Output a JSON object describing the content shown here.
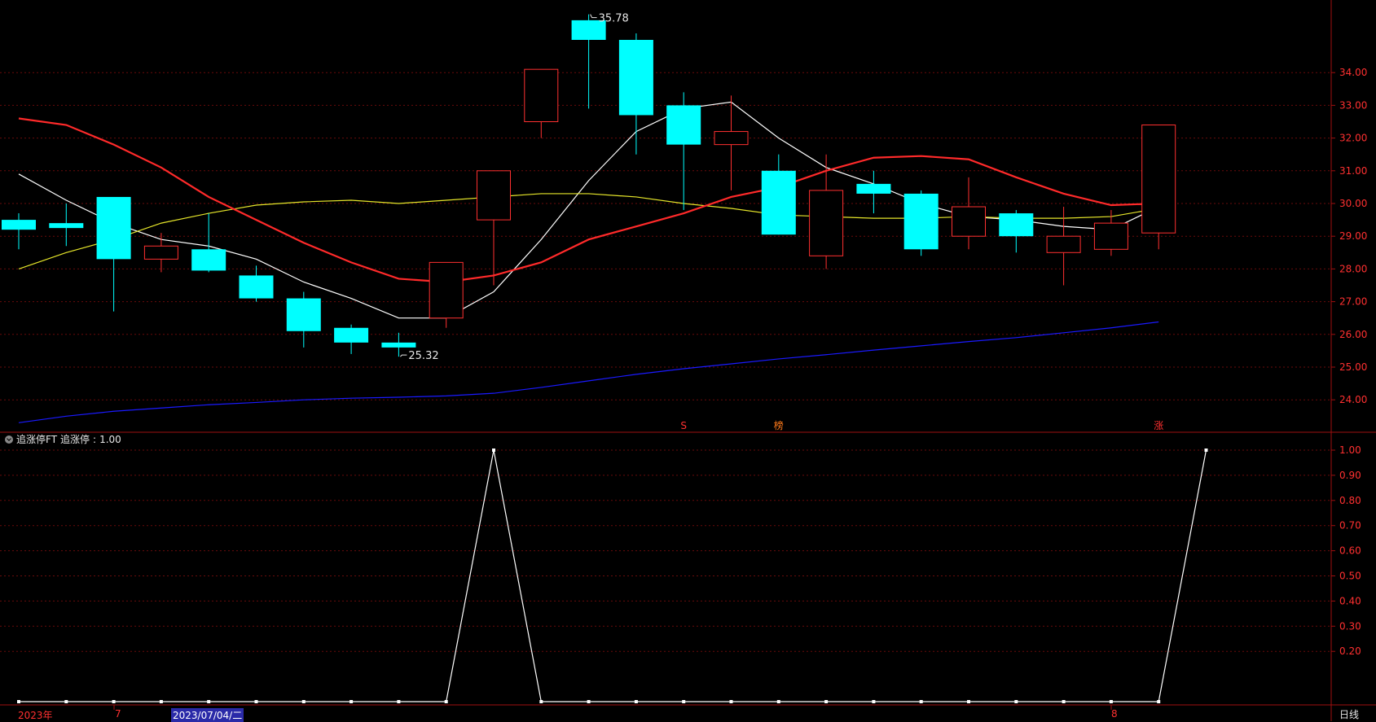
{
  "chart_data": [
    {
      "type": "candlestick",
      "ylim": [
        23.0,
        36.1
      ],
      "y_ticks": [
        "34.00",
        "33.00",
        "32.00",
        "31.00",
        "30.00",
        "29.00",
        "28.00",
        "27.00",
        "26.00",
        "25.00",
        "24.00"
      ],
      "up_color": "#ff3030",
      "down_color": "#00ffff",
      "candles": [
        {
          "o": 29.5,
          "h": 29.7,
          "l": 28.6,
          "c": 29.2
        },
        {
          "o": 29.4,
          "h": 30.0,
          "l": 28.7,
          "c": 29.25
        },
        {
          "o": 30.2,
          "h": 30.2,
          "l": 26.7,
          "c": 28.3
        },
        {
          "o": 28.3,
          "h": 29.1,
          "l": 27.9,
          "c": 28.7
        },
        {
          "o": 28.6,
          "h": 29.7,
          "l": 27.9,
          "c": 27.95
        },
        {
          "o": 27.8,
          "h": 28.1,
          "l": 27.0,
          "c": 27.1
        },
        {
          "o": 27.1,
          "h": 27.3,
          "l": 25.6,
          "c": 26.1
        },
        {
          "o": 26.2,
          "h": 26.3,
          "l": 25.4,
          "c": 25.75
        },
        {
          "o": 25.75,
          "h": 26.05,
          "l": 25.32,
          "c": 25.6
        },
        {
          "o": 26.5,
          "h": 28.2,
          "l": 26.2,
          "c": 28.2
        },
        {
          "o": 29.5,
          "h": 31.0,
          "l": 27.5,
          "c": 31.0
        },
        {
          "o": 32.5,
          "h": 34.1,
          "l": 32.0,
          "c": 34.1
        },
        {
          "o": 35.6,
          "h": 35.78,
          "l": 32.9,
          "c": 35.0
        },
        {
          "o": 35.0,
          "h": 35.2,
          "l": 31.5,
          "c": 32.7
        },
        {
          "o": 33.0,
          "h": 33.4,
          "l": 29.8,
          "c": 31.8
        },
        {
          "o": 31.8,
          "h": 33.3,
          "l": 30.4,
          "c": 32.2
        },
        {
          "o": 31.0,
          "h": 31.5,
          "l": 29.05,
          "c": 29.05
        },
        {
          "o": 28.4,
          "h": 31.5,
          "l": 28.0,
          "c": 30.4
        },
        {
          "o": 30.6,
          "h": 31.0,
          "l": 29.7,
          "c": 30.3
        },
        {
          "o": 30.3,
          "h": 30.4,
          "l": 28.4,
          "c": 28.6
        },
        {
          "o": 29.0,
          "h": 30.8,
          "l": 28.6,
          "c": 29.9
        },
        {
          "o": 29.7,
          "h": 29.8,
          "l": 28.5,
          "c": 29.0
        },
        {
          "o": 28.5,
          "h": 29.9,
          "l": 27.5,
          "c": 29.0
        },
        {
          "o": 28.6,
          "h": 29.8,
          "l": 28.4,
          "c": 29.4
        },
        {
          "o": 29.1,
          "h": 32.4,
          "l": 28.6,
          "c": 32.4
        }
      ],
      "ma_lines": [
        {
          "color": "#ffffff",
          "values": [
            30.9,
            30.1,
            29.4,
            28.9,
            28.7,
            28.3,
            27.6,
            27.1,
            26.5,
            26.5,
            27.3,
            28.9,
            30.7,
            32.2,
            32.9,
            33.1,
            32.0,
            31.1,
            30.6,
            30.0,
            29.6,
            29.5,
            29.3,
            29.2,
            29.9
          ]
        },
        {
          "color": "#e6e62a",
          "values": [
            28.0,
            28.5,
            28.9,
            29.4,
            29.7,
            29.95,
            30.05,
            30.1,
            30.0,
            30.1,
            30.2,
            30.3,
            30.3,
            30.2,
            30.0,
            29.85,
            29.65,
            29.6,
            29.55,
            29.55,
            29.6,
            29.55,
            29.55,
            29.6,
            29.85
          ]
        },
        {
          "color": "#ff2a2a",
          "values": [
            32.6,
            32.4,
            31.8,
            31.1,
            30.2,
            29.5,
            28.8,
            28.2,
            27.7,
            27.6,
            27.8,
            28.2,
            28.9,
            29.3,
            29.7,
            30.2,
            30.5,
            31.0,
            31.4,
            31.45,
            31.35,
            30.8,
            30.3,
            29.95,
            30.0
          ]
        },
        {
          "color": "#1a1aff",
          "values": [
            23.3,
            23.5,
            23.65,
            23.75,
            23.85,
            23.92,
            24.0,
            24.05,
            24.08,
            24.12,
            24.2,
            24.38,
            24.58,
            24.78,
            24.95,
            25.1,
            25.25,
            25.38,
            25.52,
            25.65,
            25.78,
            25.9,
            26.05,
            26.2,
            26.38
          ]
        }
      ],
      "annotations": [
        {
          "text": "35.78",
          "index": 12,
          "value": 35.78,
          "side": "right"
        },
        {
          "text": "25.32",
          "index": 8,
          "value": 25.32,
          "side": "right"
        }
      ],
      "markers": [
        {
          "text": "S",
          "index": 14,
          "color": "#ff3030"
        },
        {
          "text": "榜",
          "index": 16,
          "color": "#ff7a1a"
        },
        {
          "text": "涨",
          "index": 24,
          "color": "#ff3030"
        }
      ]
    },
    {
      "type": "line",
      "title": "追涨停FT",
      "series_name": "追涨停",
      "current_value": "1.00",
      "ylim": [
        0,
        1.0
      ],
      "y_ticks": [
        "1.00",
        "0.90",
        "0.80",
        "0.70",
        "0.60",
        "0.50",
        "0.40",
        "0.30",
        "0.20"
      ],
      "line_color": "#ffffff",
      "values": [
        0,
        0,
        0,
        0,
        0,
        0,
        0,
        0,
        0,
        1,
        0,
        0,
        0,
        0,
        0,
        0,
        0,
        0,
        0,
        0,
        0,
        0,
        0,
        0,
        1
      ]
    }
  ],
  "axis": {
    "dates": [
      {
        "text": "2023年",
        "color": "#ff3030",
        "highlight": false
      },
      {
        "text": "7",
        "color": "#ff3030",
        "highlight": false
      },
      {
        "text": "2023/07/04/二",
        "color": "#ffffff",
        "highlight": true
      },
      {
        "text": "8",
        "color": "#ff3030",
        "highlight": false
      }
    ],
    "period_label": "日线"
  }
}
